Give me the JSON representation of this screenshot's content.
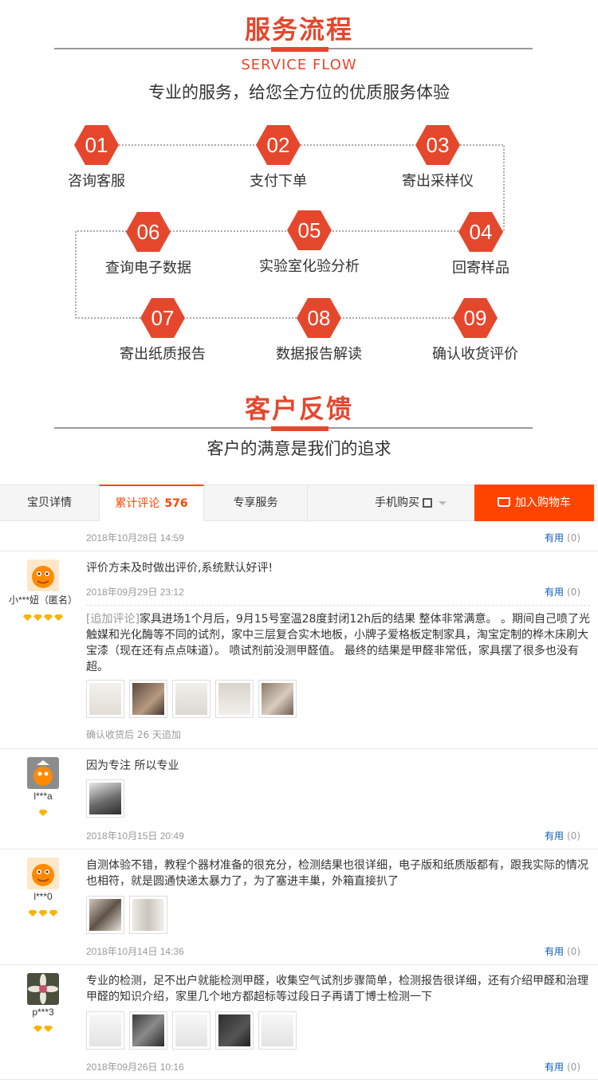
{
  "service": {
    "title": "服务流程",
    "en_title": "SERVICE FLOW",
    "subtitle": "专业的服务，给您全方位的优质服务体验",
    "steps": [
      {
        "num": "01",
        "label": "咨询客服"
      },
      {
        "num": "02",
        "label": "支付下单"
      },
      {
        "num": "03",
        "label": "寄出采样仪"
      },
      {
        "num": "04",
        "label": "回寄样品"
      },
      {
        "num": "05",
        "label": "实验室化验分析"
      },
      {
        "num": "06",
        "label": "查询电子数据"
      },
      {
        "num": "07",
        "label": "寄出纸质报告"
      },
      {
        "num": "08",
        "label": "数据报告解读"
      },
      {
        "num": "09",
        "label": "确认收货评价"
      }
    ]
  },
  "feedback": {
    "title": "客户反馈",
    "subtitle": "客户的满意是我们的追求"
  },
  "tabs": {
    "detail": "宝贝详情",
    "reviews": "累计评论",
    "reviews_count": "576",
    "service": "专享服务",
    "mobile_buy": "手机购买",
    "add_to_cart": "加入购物车"
  },
  "reviews": [
    {
      "date": "2018年10月28日 14:59",
      "useful": "有用",
      "useful_count": "(0)"
    },
    {
      "user": "小***妞（匿名）",
      "diamonds": 4,
      "text": "评价方未及时做出评价,系统默认好评!",
      "date": "2018年09月29日 23:12",
      "useful": "有用",
      "useful_count": "(0)",
      "append_tag": "[追加评论]",
      "append_text": "家具进场1个月后，9月15号室温28度封闭12h后的结果 整体非常满意。 。期间自己喷了光触媒和光化酶等不同的试剂，家中三层复合实木地板，小牌子爱格板定制家具，淘宝定制的桦木床刷大宝漆（现在还有点点味道）。 喷试剂前没测甲醛值。 最终的结果是甲醛非常低，家具摆了很多也没有超。",
      "append_note": "确认收货后 26 天追加",
      "thumb_count": 5
    },
    {
      "user": "l***a",
      "diamonds": 1,
      "text": "因为专注 所以专业",
      "date": "2018年10月15日 20:49",
      "useful": "有用",
      "useful_count": "(0)",
      "thumb_count": 1
    },
    {
      "user": "l***0",
      "diamonds": 3,
      "text": "自测体验不错，教程个器材准备的很充分，检测结果也很详细，电子版和纸质版都有，跟我实际的情况也相符，就是圆通快递太暴力了，为了塞进丰巢，外箱直接扒了",
      "date": "2018年10月14日 14:36",
      "useful": "有用",
      "useful_count": "(0)",
      "thumb_count": 2
    },
    {
      "user": "p***3",
      "diamonds": 2,
      "text": "专业的检测，足不出户就能检测甲醛，收集空气试剂步骤简单，检测报告很详细，还有介绍甲醛和治理甲醛的知识介绍，家里几个地方都超标等过段日子再请丁博士检测一下",
      "date": "2018年09月26日 10:16",
      "useful": "有用",
      "useful_count": "(0)",
      "thumb_count": 5
    }
  ],
  "colors": {
    "accent": "#e5472d",
    "taobao_orange": "#ff4400",
    "link_blue": "#0d5dbb",
    "diamond": "#f7b500"
  }
}
